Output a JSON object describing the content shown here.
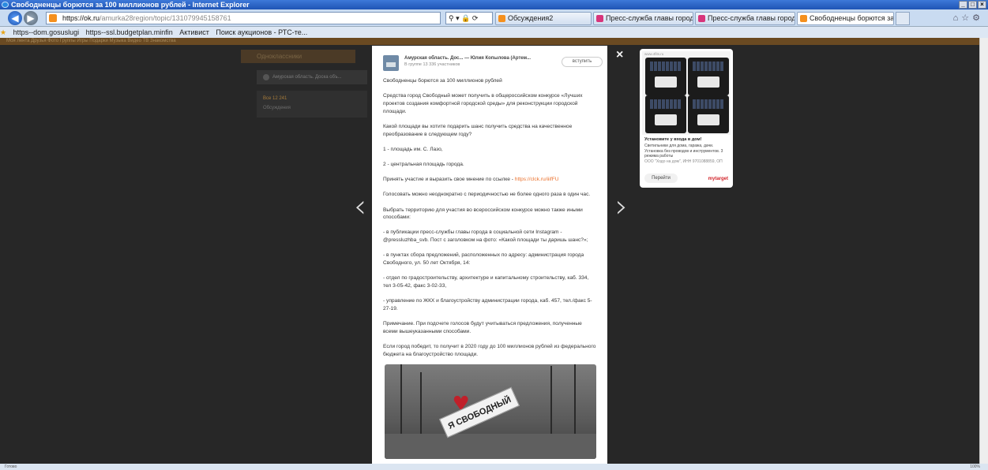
{
  "window": {
    "title": "Свободненцы борются за 100 миллионов рублей - Internet Explorer",
    "buttons": [
      "_",
      "□",
      "×"
    ]
  },
  "address": {
    "url_host": "https://ok.ru",
    "url_path": "/amurka28region/topic/131079945158761",
    "tools": "⚲ ▾ 🔒 ⟳"
  },
  "tabs": [
    {
      "label": "Обсуждения2",
      "color": "#f5901e",
      "active": false
    },
    {
      "label": "Пресс-служба главы города в...",
      "color": "#d8357b",
      "active": false
    },
    {
      "label": "Пресс-служба главы города в...",
      "color": "#d8357b",
      "active": false
    },
    {
      "label": "Свободненцы борются за ... ×",
      "color": "#f5901e",
      "active": true
    }
  ],
  "favorites": [
    "https--dom.gosuslugi",
    "https--ssl.budgetplan.minfin",
    "Активист",
    "Поиск аукционов - РТС-те..."
  ],
  "ok_topbar": "Моя лента    Друзья    Фото    Группы    Игры    Подарки    Музыка    Видео    ТВ    Знакомства",
  "background": {
    "header": "Одноклассники",
    "card": "Амурская область. Доска объ...",
    "menu_active": "Все   12 241",
    "menu_item": "Обсуждения"
  },
  "post": {
    "group": "Амурская область. Дос...  — Юлия Копылова (Артем...",
    "members": "В группе 13 336 участников",
    "join": "вступить",
    "paragraphs": [
      "Свободненцы борются за 100 миллионов рублей",
      "Средства город Свободный может получить в общероссийском конкурсе «Лучших проектов создания комфортной городской среды» для реконструкции городской площади.",
      "Какой площади вы хотите подарить шанс получить средства на качественное преобразование в следующем году?",
      "1 - площадь им. С. Лазо,",
      "2 - центральная площадь города.",
      "Голосовать можно неоднократно с периодичностью не более одного раза в один час.",
      "Выбрать территорию для участия во всероссийском конкурсе можно также иными способами:",
      "- в публикации пресс-службы главы города в социальной сети Instagram - @pressluzhba_svb. Пост с заголовком на фото: «Какой площади ты даришь шанс?»;",
      "- в пунктах сбора предложений, расположенных по адресу: администрация города Свободного, ул. 50 лет Октября, 14:",
      "- отдел по градостроительству, архитектуре и капитальному строительству, каб. 334, тел 3-05-42, факс 3-02-33,",
      "- управление по ЖКХ и благоустройству администрации города, каб. 457, тел./факс 5-27-19.",
      "Примечание. При подсчете голосов будут учитываться предложения, полученные всеми вышеуказанными способами.",
      "Если город победит, то получит в 2020 году до 100 миллионов рублей из федерального бюджета на благоустройство площади."
    ],
    "link_lead": "Принять участие и выразить свое мнение по ссылке - ",
    "link_text": "https://clck.ru/iiifFU",
    "photo_sign": "СВОБОДНЫЙ",
    "photo_letter": "Я",
    "photo_heart": "♥"
  },
  "nav": {
    "prev": "‹",
    "next": "›",
    "close": "×"
  },
  "ad": {
    "label": "www.4fits.ru",
    "title": "Установите у входа в дом!",
    "text": "Светильники для дома, гаража, дачи. Установка без проводов и инструментов. 3 режима работы",
    "text2": "ООО \"Ходо на дом\", ИНН 9701088859, ОП",
    "button": "Перейти",
    "logo": "mytarget"
  },
  "status": {
    "left": "Готово",
    "zoom": "100%"
  }
}
